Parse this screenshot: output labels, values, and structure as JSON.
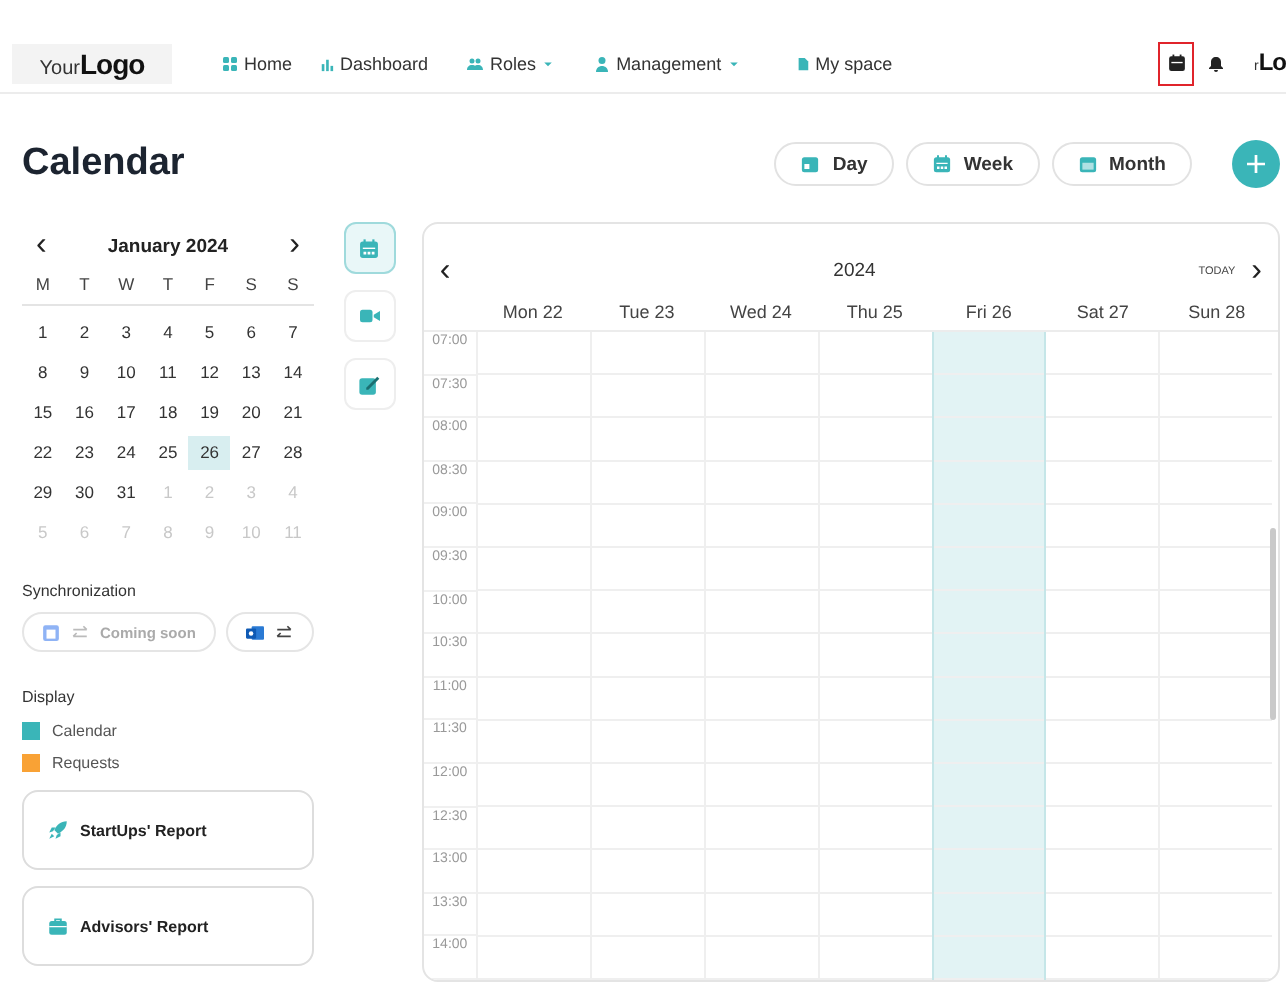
{
  "header": {
    "logo": {
      "small": "Your",
      "large": "Logo"
    },
    "nav": [
      {
        "label": "Home",
        "kind": "grid",
        "dropdown": false
      },
      {
        "label": "Dashboard",
        "kind": "chart",
        "dropdown": false
      },
      {
        "label": "Roles",
        "kind": "users",
        "dropdown": true
      },
      {
        "label": "Management",
        "kind": "user",
        "dropdown": true
      },
      {
        "label": "My space",
        "kind": "file",
        "dropdown": false
      }
    ],
    "calendar_icon": {
      "marked": true
    },
    "avatar": {
      "small": "r",
      "large": "Lo"
    }
  },
  "title": "Calendar",
  "views": [
    {
      "label": "Day",
      "kind": "day"
    },
    {
      "label": "Week",
      "kind": "week"
    },
    {
      "label": "Month",
      "kind": "month"
    }
  ],
  "mini_calendar": {
    "month": "January 2024",
    "prev": "‹",
    "next": "›",
    "weekdays": [
      "M",
      "T",
      "W",
      "T",
      "F",
      "S",
      "S"
    ],
    "weeks": [
      [
        {
          "day": "1",
          "outside": false,
          "selected": false
        },
        {
          "day": "2",
          "outside": false,
          "selected": false
        },
        {
          "day": "3",
          "outside": false,
          "selected": false
        },
        {
          "day": "4",
          "outside": false,
          "selected": false
        },
        {
          "day": "5",
          "outside": false,
          "selected": false
        },
        {
          "day": "6",
          "outside": false,
          "selected": false
        },
        {
          "day": "7",
          "outside": false,
          "selected": false
        }
      ],
      [
        {
          "day": "8",
          "outside": false,
          "selected": false
        },
        {
          "day": "9",
          "outside": false,
          "selected": false
        },
        {
          "day": "10",
          "outside": false,
          "selected": false
        },
        {
          "day": "11",
          "outside": false,
          "selected": false
        },
        {
          "day": "12",
          "outside": false,
          "selected": false
        },
        {
          "day": "13",
          "outside": false,
          "selected": false
        },
        {
          "day": "14",
          "outside": false,
          "selected": false
        }
      ],
      [
        {
          "day": "15",
          "outside": false,
          "selected": false
        },
        {
          "day": "16",
          "outside": false,
          "selected": false
        },
        {
          "day": "17",
          "outside": false,
          "selected": false
        },
        {
          "day": "18",
          "outside": false,
          "selected": false
        },
        {
          "day": "19",
          "outside": false,
          "selected": false
        },
        {
          "day": "20",
          "outside": false,
          "selected": false
        },
        {
          "day": "21",
          "outside": false,
          "selected": false
        }
      ],
      [
        {
          "day": "22",
          "outside": false,
          "selected": false
        },
        {
          "day": "23",
          "outside": false,
          "selected": false
        },
        {
          "day": "24",
          "outside": false,
          "selected": false
        },
        {
          "day": "25",
          "outside": false,
          "selected": false
        },
        {
          "day": "26",
          "outside": false,
          "selected": true
        },
        {
          "day": "27",
          "outside": false,
          "selected": false
        },
        {
          "day": "28",
          "outside": false,
          "selected": false
        }
      ],
      [
        {
          "day": "29",
          "outside": false,
          "selected": false
        },
        {
          "day": "30",
          "outside": false,
          "selected": false
        },
        {
          "day": "31",
          "outside": false,
          "selected": false
        },
        {
          "day": "1",
          "outside": true,
          "selected": false
        },
        {
          "day": "2",
          "outside": true,
          "selected": false
        },
        {
          "day": "3",
          "outside": true,
          "selected": false
        },
        {
          "day": "4",
          "outside": true,
          "selected": false
        }
      ],
      [
        {
          "day": "5",
          "outside": true,
          "selected": false
        },
        {
          "day": "6",
          "outside": true,
          "selected": false
        },
        {
          "day": "7",
          "outside": true,
          "selected": false
        },
        {
          "day": "8",
          "outside": true,
          "selected": false
        },
        {
          "day": "9",
          "outside": true,
          "selected": false
        },
        {
          "day": "10",
          "outside": true,
          "selected": false
        },
        {
          "day": "11",
          "outside": true,
          "selected": false
        }
      ]
    ]
  },
  "side_tools": [
    {
      "kind": "calendar",
      "selected": true
    },
    {
      "kind": "video",
      "selected": false
    },
    {
      "kind": "edit",
      "selected": false
    }
  ],
  "synchronization": {
    "label": "Synchronization",
    "buttons": [
      {
        "kind": "google",
        "text": "Coming soon",
        "disabled": true
      },
      {
        "kind": "outlook",
        "disabled": false
      }
    ]
  },
  "display": {
    "label": "Display",
    "items": [
      {
        "label": "Calendar",
        "color": "#3ab5b8"
      },
      {
        "label": "Requests",
        "color": "#f9a235"
      }
    ]
  },
  "reports": [
    {
      "label": "StartUps' Report",
      "kind": "rocket"
    },
    {
      "label": "Advisors' Report",
      "kind": "briefcase"
    }
  ],
  "week_view": {
    "year": "2024",
    "prev": "‹",
    "next": "›",
    "today": "TODAY",
    "days": [
      {
        "label": "Mon 22",
        "selected": false
      },
      {
        "label": "Tue 23",
        "selected": false
      },
      {
        "label": "Wed 24",
        "selected": false
      },
      {
        "label": "Thu 25",
        "selected": false
      },
      {
        "label": "Fri 26",
        "selected": true
      },
      {
        "label": "Sat 27",
        "selected": false
      },
      {
        "label": "Sun 28",
        "selected": false
      }
    ],
    "times": [
      "07:00",
      "07:30",
      "08:00",
      "08:30",
      "09:00",
      "09:30",
      "10:00",
      "10:30",
      "11:00",
      "11:30",
      "12:00",
      "12:30",
      "13:00",
      "13:30",
      "14:00"
    ]
  }
}
